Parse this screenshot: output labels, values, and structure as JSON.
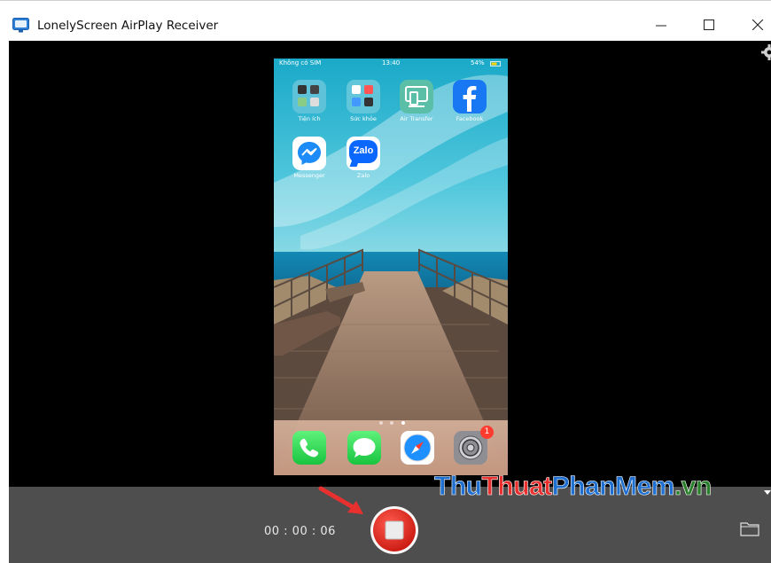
{
  "window": {
    "title": "LonelyScreen AirPlay Receiver",
    "controls": {
      "minimize": "minimize-icon",
      "maximize": "maximize-icon",
      "close": "close-icon"
    }
  },
  "phone": {
    "status_bar": {
      "carrier": "Không có SIM",
      "time": "13:40",
      "battery": "54%"
    },
    "home_apps": [
      {
        "label": "Tiện ích",
        "icon": "utilities-folder-icon"
      },
      {
        "label": "Sức khỏe",
        "icon": "health-folder-icon"
      },
      {
        "label": "Air Transfer",
        "icon": "air-transfer-icon"
      },
      {
        "label": "Facebook",
        "icon": "facebook-icon"
      },
      {
        "label": "Messenger",
        "icon": "messenger-icon"
      },
      {
        "label": "Zalo",
        "icon": "zalo-icon",
        "glyph": "Zalo"
      }
    ],
    "page_dots": 3,
    "dock": [
      {
        "icon": "phone-icon"
      },
      {
        "icon": "messages-icon"
      },
      {
        "icon": "safari-icon"
      },
      {
        "icon": "settings-icon",
        "badge": "1"
      }
    ]
  },
  "controls": {
    "timer": "00 : 00 : 06",
    "stop_icon": "stop-record-icon",
    "folder_icon": "folder-icon",
    "settings_icon": "gear-icon"
  },
  "watermark": {
    "part1": "Thu",
    "part2": "Thuat",
    "part3": "PhanMem",
    "part4": ".vn"
  },
  "colors": {
    "titlebar": "#ffffff",
    "viewer_bg": "#000000",
    "control_bar": "#4e4e4e",
    "record_red": "#e5251e"
  }
}
